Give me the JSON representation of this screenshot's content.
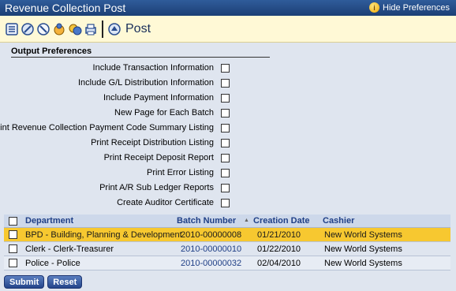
{
  "window": {
    "title": "Revenue Collection Post",
    "hide_prefs_label": "Hide Preferences"
  },
  "toolbar": {
    "icons": [
      "list-icon",
      "edit-icon",
      "cancel-icon",
      "fund-icon",
      "gl-icon",
      "print-icon",
      "post-icon"
    ],
    "post_label": "Post"
  },
  "preferences": {
    "header": "Output Preferences",
    "options": [
      {
        "label": "Include Transaction Information",
        "checked": false
      },
      {
        "label": "Include G/L Distribution Information",
        "checked": false
      },
      {
        "label": "Include Payment Information",
        "checked": false
      },
      {
        "label": "New Page for Each Batch",
        "checked": false
      },
      {
        "label": "Print Revenue Collection Payment Code Summary Listing",
        "checked": false
      },
      {
        "label": "Print Receipt Distribution Listing",
        "checked": false
      },
      {
        "label": "Print Receipt Deposit Report",
        "checked": false
      },
      {
        "label": "Print Error Listing",
        "checked": false
      },
      {
        "label": "Print A/R Sub Ledger Reports",
        "checked": false
      },
      {
        "label": "Create Auditor Certificate",
        "checked": false
      }
    ]
  },
  "grid": {
    "columns": [
      "Department",
      "Batch Number",
      "Creation Date",
      "Cashier"
    ],
    "rows": [
      {
        "department": "BPD - Building, Planning & Development",
        "batch": "2010-00000008",
        "date": "01/21/2010",
        "cashier": "New World Systems",
        "selected": true
      },
      {
        "department": "Clerk - Clerk-Treasurer",
        "batch": "2010-00000010",
        "date": "01/22/2010",
        "cashier": "New World Systems",
        "selected": false
      },
      {
        "department": "Police - Police",
        "batch": "2010-00000032",
        "date": "02/04/2010",
        "cashier": "New World Systems",
        "selected": false
      }
    ]
  },
  "buttons": {
    "submit": "Submit",
    "reset": "Reset"
  },
  "colors": {
    "titlebar": "#1c3f75",
    "toolbar": "#fff9d6",
    "selected_row": "#f7c830",
    "background": "#dfe5ef"
  }
}
